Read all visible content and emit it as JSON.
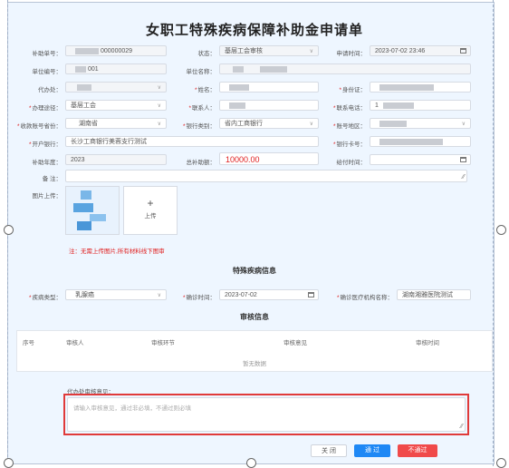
{
  "title": "女职工特殊疾病保障补助金申请单",
  "form": {
    "subsidy_no_label": "补助单号：",
    "subsidy_no_value": "000000029",
    "status_label": "状态：",
    "status_value": "基层工会审核",
    "apply_time_label": "申请时间：",
    "apply_time_value": "2023-07-02 23:46",
    "unit_no_label": "单位编号：",
    "unit_no_value": "001",
    "unit_name_label": "单位名称：",
    "agent_label": "代办处：",
    "name_label": "姓名：",
    "id_card_label": "身份证：",
    "route_label": "办理途径：",
    "route_value": "基层工会",
    "contact_label": "联系人：",
    "phone_label": "联系电话：",
    "phone_value": "1",
    "province_label": "收款账号省份：",
    "province_value": "湖南省",
    "bank_type_label": "银行类别：",
    "bank_type_value": "省内工商银行",
    "account_region_label": "账号地区：",
    "bank_branch_label": "开户银行：",
    "bank_branch_value": "长沙工商银行美蓉支行测试",
    "card_no_label": "银行卡号：",
    "year_label": "补助年度：",
    "year_value": "2023",
    "amount_label": "总补助额：",
    "amount_value": "10000.00",
    "pay_time_label": "给付时间：",
    "remark_label": "备 注：",
    "image_upload_label": "图片上传：",
    "upload_text": "上传",
    "upload_plus": "+",
    "note": "注：无需上传图片,所有材料线下图审"
  },
  "disease_section": {
    "heading": "特殊疾病信息",
    "type_label": "疾病类型：",
    "type_value": "乳腺癌",
    "diag_time_label": "确诊时间：",
    "diag_time_value": "2023-07-02",
    "hospital_label": "确诊医疗机构名称：",
    "hospital_value": "湖南湘雅医院测试"
  },
  "review_section": {
    "heading": "审核信息",
    "columns": [
      "序号",
      "审核人",
      "审核环节",
      "审核意见",
      "审核时间"
    ],
    "empty_text": "暂无数据"
  },
  "opinion": {
    "label": "代办处审核意见：",
    "placeholder": "请输入审核意见，通过非必填，不通过则必填"
  },
  "buttons": {
    "close": "关 闭",
    "pass": "通 过",
    "fail": "不通过"
  },
  "colors": {
    "primary": "#1e88f5",
    "danger": "#f04a4a",
    "highlight_border": "#e03a3a"
  }
}
